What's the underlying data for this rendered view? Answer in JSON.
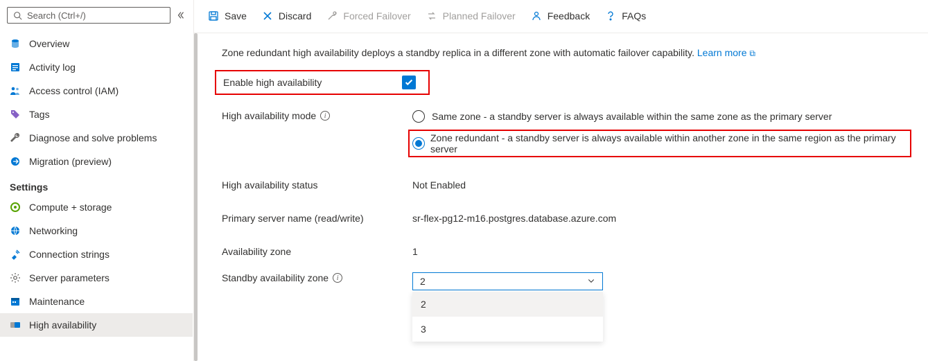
{
  "search": {
    "placeholder": "Search (Ctrl+/)"
  },
  "sidebar": {
    "top": [
      {
        "label": "Overview"
      },
      {
        "label": "Activity log"
      },
      {
        "label": "Access control (IAM)"
      },
      {
        "label": "Tags"
      },
      {
        "label": "Diagnose and solve problems"
      },
      {
        "label": "Migration (preview)"
      }
    ],
    "section": "Settings",
    "settings": [
      {
        "label": "Compute + storage"
      },
      {
        "label": "Networking"
      },
      {
        "label": "Connection strings"
      },
      {
        "label": "Server parameters"
      },
      {
        "label": "Maintenance"
      },
      {
        "label": "High availability"
      }
    ]
  },
  "toolbar": {
    "save": "Save",
    "discard": "Discard",
    "forced": "Forced Failover",
    "planned": "Planned Failover",
    "feedback": "Feedback",
    "faqs": "FAQs"
  },
  "intro": {
    "text": "Zone redundant high availability deploys a standby replica in a different zone with automatic failover capability. ",
    "link": "Learn more"
  },
  "form": {
    "enable_label": "Enable high availability",
    "mode_label": "High availability mode",
    "mode_same": "Same zone - a standby server is always available within the same zone as the primary server",
    "mode_zone": "Zone redundant - a standby server is always available within another zone in the same region as the primary server",
    "status_label": "High availability status",
    "status_value": "Not Enabled",
    "primary_label": "Primary server name (read/write)",
    "primary_value": "sr-flex-pg12-m16.postgres.database.azure.com",
    "avail_label": "Availability zone",
    "avail_value": "1",
    "standby_label": "Standby availability zone",
    "standby_value": "2",
    "options": [
      "2",
      "3"
    ]
  }
}
